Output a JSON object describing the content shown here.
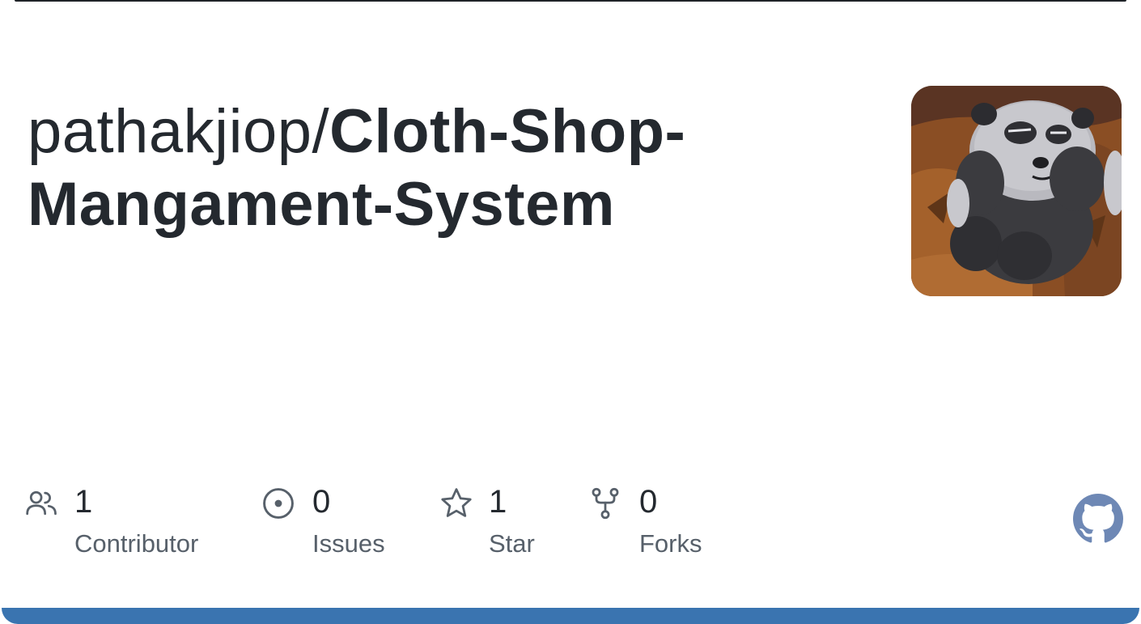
{
  "repo": {
    "owner": "pathakjiop/",
    "name_line1": "Cloth-Shop-",
    "name_line2": "Mangament-System"
  },
  "avatar": {
    "icon": "panda-avatar-image"
  },
  "stats": [
    {
      "icon": "people-icon",
      "value": "1",
      "label": "Contributor"
    },
    {
      "icon": "issue-icon",
      "value": "0",
      "label": "Issues"
    },
    {
      "icon": "star-icon",
      "value": "1",
      "label": "Star"
    },
    {
      "icon": "fork-icon",
      "value": "0",
      "label": "Forks"
    }
  ],
  "colors": {
    "text": "#24292f",
    "muted": "#57606a",
    "icon": "#57606a",
    "accent_bar": "#3a74b0",
    "github_mark": "#6e88b5"
  }
}
